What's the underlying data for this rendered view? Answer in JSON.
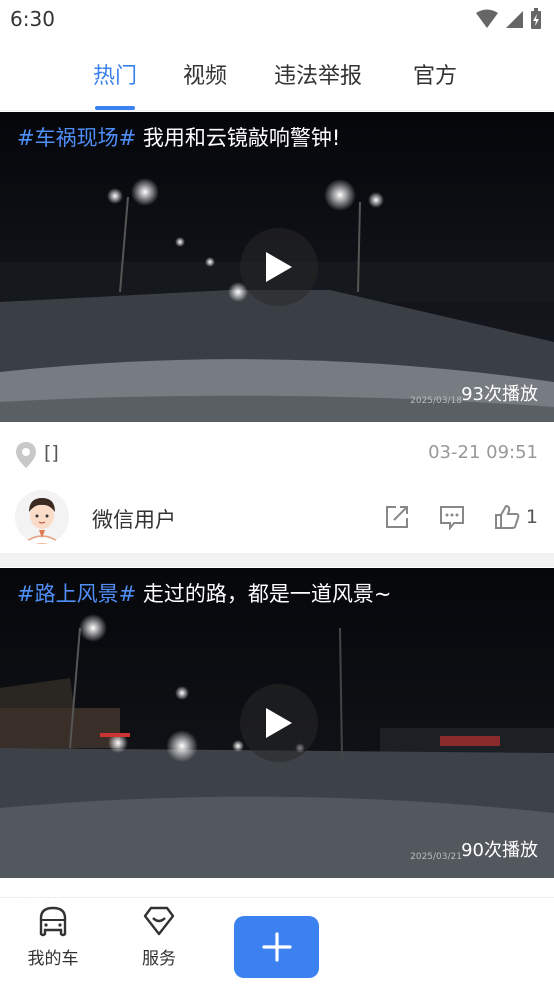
{
  "status_bar": {
    "time": "6:30"
  },
  "tabs": [
    {
      "label": "热门",
      "active": true
    },
    {
      "label": "视频",
      "active": false
    },
    {
      "label": "违法举报",
      "active": false
    },
    {
      "label": "官方",
      "active": false
    }
  ],
  "posts": [
    {
      "tag": "#车祸现场#",
      "title": "我用和云镜敲响警钟!",
      "play_count": "93次播放",
      "stamp": "2025/03/18",
      "location": "[]",
      "time": "03-21 09:51",
      "username": "微信用户",
      "like_count": "1"
    },
    {
      "tag": "#路上风景#",
      "title": "走过的路，都是一道风景~",
      "play_count": "90次播放",
      "stamp": "2025/03/21",
      "location": "[]"
    }
  ],
  "bottom_nav": {
    "my_car": "我的车",
    "service": "服务"
  },
  "colors": {
    "accent": "#3b82f0",
    "tag": "#4f8ff7"
  },
  "icons": [
    "signal-icon",
    "battery-icon",
    "play-icon",
    "location-icon",
    "share-icon",
    "comment-icon",
    "like-icon",
    "car-icon",
    "service-icon",
    "plus-icon"
  ]
}
